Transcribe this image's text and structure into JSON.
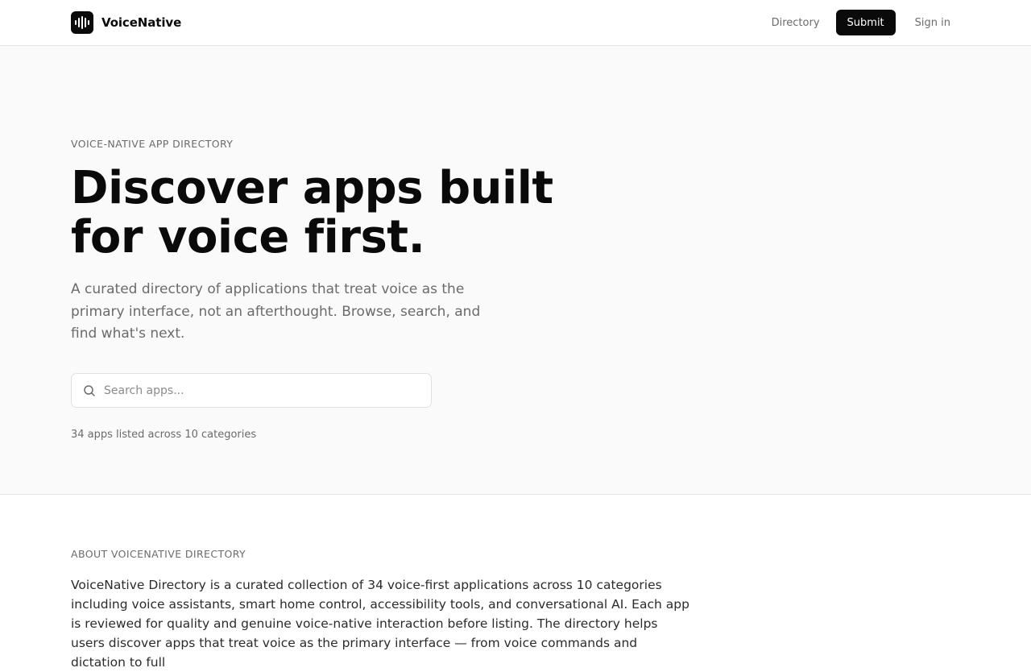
{
  "header": {
    "brand": "VoiceNative",
    "logo_icon": "waveform-icon",
    "nav": {
      "directory": "Directory",
      "submit": "Submit",
      "signin": "Sign in"
    }
  },
  "hero": {
    "eyebrow": "VOICE-NATIVE APP DIRECTORY",
    "headline_line1": "Discover apps built",
    "headline_line2": "for voice first.",
    "subtext": "A curated directory of applications that treat voice as the primary interface, not an afterthought. Browse, search, and find what's next.",
    "search": {
      "placeholder": "Search apps...",
      "value": "",
      "icon": "search-icon"
    },
    "stats": "34 apps listed across 10 categories"
  },
  "about": {
    "eyebrow": "ABOUT VOICENATIVE DIRECTORY",
    "body": "VoiceNative Directory is a curated collection of 34 voice-first applications across 10 categories including voice assistants, smart home control, accessibility tools, and conversational AI. Each app is reviewed for quality and genuine voice-native interaction before listing. The directory helps users discover apps that treat voice as the primary interface — from voice commands and dictation to full"
  },
  "colors": {
    "primary": "#0a0a0a",
    "muted_text": "#6b6b6b",
    "hero_bg": "#fafafa",
    "border": "#e5e5e5"
  }
}
